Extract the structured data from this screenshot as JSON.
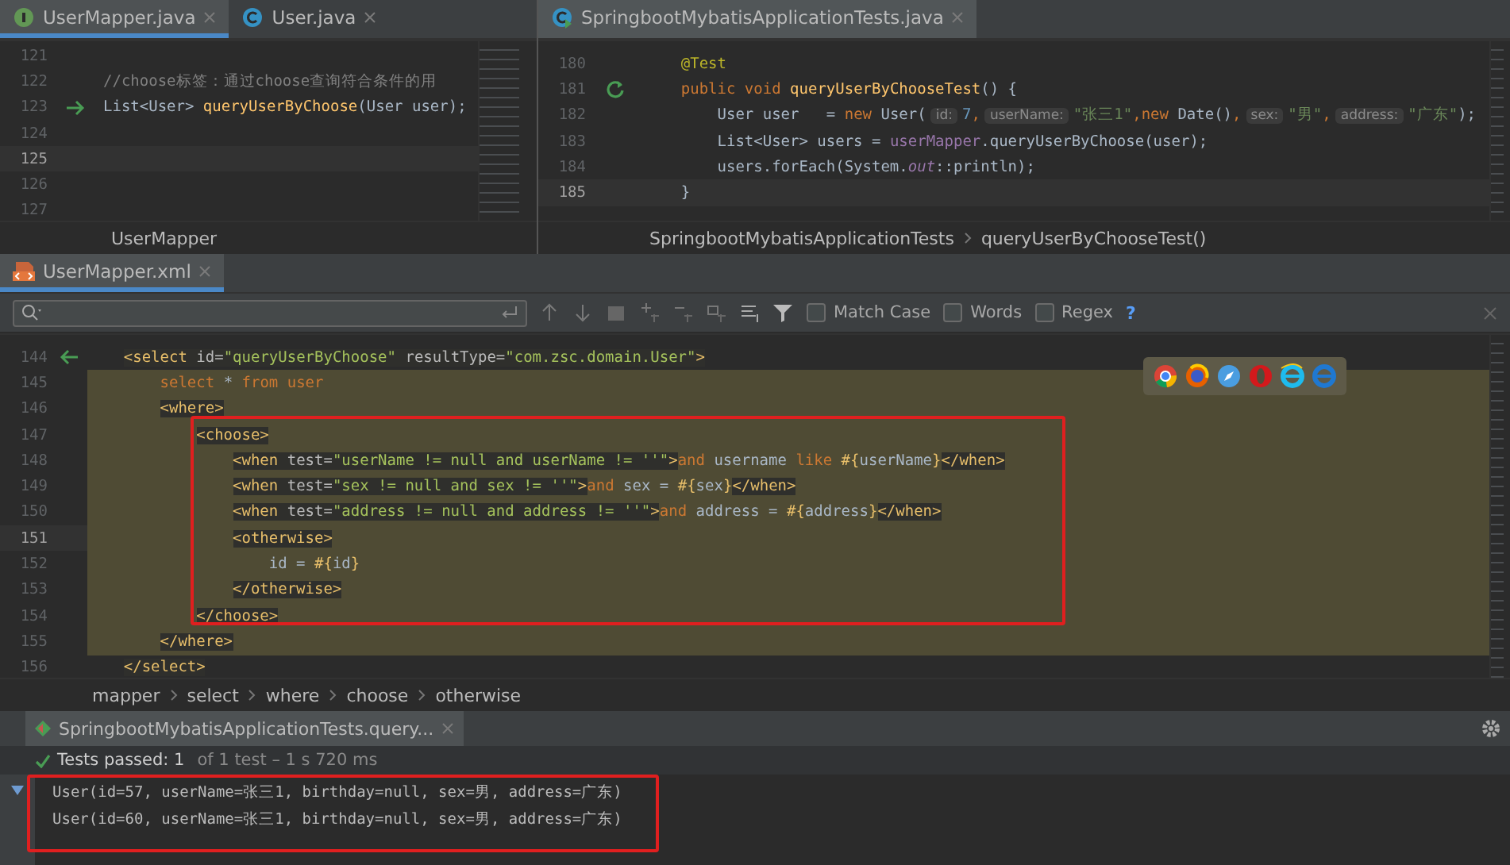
{
  "editors": [
    {
      "tabs": [
        {
          "label": "UserMapper.java",
          "kind": "interface",
          "selected": true
        },
        {
          "label": "User.java",
          "kind": "class",
          "selected": false
        }
      ],
      "lines": [
        {
          "number": "121",
          "current": false
        },
        {
          "number": "122",
          "current": false,
          "tokens": [
            {
              "text": "//choose标签：通过choose查询符合条件的用",
              "kind": "comment"
            }
          ]
        },
        {
          "number": "123",
          "current": false,
          "marker": {
            "kind": "implemented"
          },
          "tokens": [
            {
              "text": "List<User> ",
              "kind": "plain"
            },
            {
              "text": "queryUserByChoose",
              "kind": "method"
            },
            {
              "text": "(User user);",
              "kind": "plain"
            }
          ]
        },
        {
          "number": "124",
          "current": false
        },
        {
          "number": "125",
          "current": true
        },
        {
          "number": "126",
          "current": false
        },
        {
          "number": "127",
          "current": false
        }
      ],
      "breadcrumb": [
        "UserMapper"
      ]
    },
    {
      "tabs": [
        {
          "label": "SpringbootMybatisApplicationTests.java",
          "kind": "test-class",
          "selected": true
        }
      ],
      "lines": [
        {
          "number": "180",
          "current": false,
          "tokens": [
            {
              "text": "    @Test",
              "kind": "annotation"
            }
          ]
        },
        {
          "number": "181",
          "current": false,
          "marker": {
            "kind": "run"
          },
          "tokens": [
            {
              "text": "    public void ",
              "kind": "keyword"
            },
            {
              "text": "queryUserByChooseTest",
              "kind": "method"
            },
            {
              "text": "() {",
              "kind": "plain"
            }
          ]
        },
        {
          "number": "182",
          "current": false,
          "tokens": [
            {
              "text": "        User user   = ",
              "kind": "plain"
            },
            {
              "text": "new ",
              "kind": "keyword"
            },
            {
              "text": "User(",
              "kind": "plain"
            },
            {
              "text": "id:",
              "kind": "hint"
            },
            {
              "text": "7",
              "kind": "number"
            },
            {
              "text": ",",
              "kind": "keyword"
            },
            {
              "text": "userName:",
              "kind": "hint"
            },
            {
              "text": "\"张三1\"",
              "kind": "string"
            },
            {
              "text": ",new ",
              "kind": "keyword"
            },
            {
              "text": "Date()",
              "kind": "plain"
            },
            {
              "text": ",",
              "kind": "keyword"
            },
            {
              "text": "sex:",
              "kind": "hint"
            },
            {
              "text": "\"男\"",
              "kind": "string"
            },
            {
              "text": ",",
              "kind": "keyword"
            },
            {
              "text": "address:",
              "kind": "hint"
            },
            {
              "text": "\"广东\"",
              "kind": "string"
            },
            {
              "text": ");",
              "kind": "plain"
            }
          ]
        },
        {
          "number": "183",
          "current": false,
          "tokens": [
            {
              "text": "        List<User> users = ",
              "kind": "plain"
            },
            {
              "text": "userMapper",
              "kind": "field"
            },
            {
              "text": ".queryUserByChoose(user);",
              "kind": "plain"
            }
          ]
        },
        {
          "number": "184",
          "current": false,
          "tokens": [
            {
              "text": "        users.forEach(System.",
              "kind": "plain"
            },
            {
              "text": "out",
              "kind": "static"
            },
            {
              "text": "::println);",
              "kind": "plain"
            }
          ]
        },
        {
          "number": "185",
          "current": true,
          "tokens": [
            {
              "text": "    }",
              "kind": "plain"
            }
          ]
        }
      ],
      "breadcrumb": [
        "SpringbootMybatisApplicationTests",
        "queryUserByChooseTest()"
      ]
    }
  ],
  "xml_editor": {
    "tabs": [
      {
        "label": "UserMapper.xml",
        "kind": "xml",
        "selected": true
      }
    ],
    "find_bar": {
      "options": [
        {
          "label": "Match Case",
          "checked": false
        },
        {
          "label": "Words",
          "checked": false
        },
        {
          "label": "Regex",
          "checked": false
        }
      ],
      "help": "?"
    },
    "lines": [
      {
        "number": "144",
        "current": false,
        "highlighted": false,
        "marker": {
          "kind": "implementing"
        },
        "tokens": [
          {
            "text": "    <select",
            "kind": "tag"
          },
          {
            "text": " id=",
            "kind": "attr"
          },
          {
            "text": "\"queryUserByChoose\"",
            "kind": "value"
          },
          {
            "text": " resultType=",
            "kind": "attr"
          },
          {
            "text": "\"com.zsc.domain.User\"",
            "kind": "value"
          },
          {
            "text": ">",
            "kind": "tag"
          }
        ]
      },
      {
        "number": "145",
        "current": false,
        "highlighted": true,
        "tokens": [
          {
            "text": "        select ",
            "kind": "sql"
          },
          {
            "text": "* ",
            "kind": "plain"
          },
          {
            "text": "from user",
            "kind": "sql"
          }
        ]
      },
      {
        "number": "146",
        "current": false,
        "highlighted": true,
        "tokens": [
          {
            "text": "        <where>",
            "kind": "tag"
          }
        ]
      },
      {
        "number": "147",
        "current": false,
        "highlighted": true,
        "tokens": [
          {
            "text": "            <choose>",
            "kind": "tag"
          }
        ]
      },
      {
        "number": "148",
        "current": false,
        "highlighted": true,
        "tokens": [
          {
            "text": "                <when",
            "kind": "tag"
          },
          {
            "text": " test=",
            "kind": "attr"
          },
          {
            "text": "\"userName != null and userName != ''\"",
            "kind": "value"
          },
          {
            "text": ">",
            "kind": "tag"
          },
          {
            "text": "and ",
            "kind": "sql"
          },
          {
            "text": "username ",
            "kind": "plain"
          },
          {
            "text": "like ",
            "kind": "sql"
          },
          {
            "text": "#{",
            "kind": "param"
          },
          {
            "text": "userName",
            "kind": "plain"
          },
          {
            "text": "}",
            "kind": "param"
          },
          {
            "text": "</when>",
            "kind": "tag"
          }
        ]
      },
      {
        "number": "149",
        "current": false,
        "highlighted": true,
        "tokens": [
          {
            "text": "                <when",
            "kind": "tag"
          },
          {
            "text": " test=",
            "kind": "attr"
          },
          {
            "text": "\"sex != null and sex != ''\"",
            "kind": "value"
          },
          {
            "text": ">",
            "kind": "tag"
          },
          {
            "text": "and ",
            "kind": "sql"
          },
          {
            "text": "sex = ",
            "kind": "plain"
          },
          {
            "text": "#{",
            "kind": "param"
          },
          {
            "text": "sex",
            "kind": "plain"
          },
          {
            "text": "}",
            "kind": "param"
          },
          {
            "text": "</when>",
            "kind": "tag"
          }
        ]
      },
      {
        "number": "150",
        "current": false,
        "highlighted": true,
        "tokens": [
          {
            "text": "                <when",
            "kind": "tag"
          },
          {
            "text": " test=",
            "kind": "attr"
          },
          {
            "text": "\"address != null and address != ''\"",
            "kind": "value"
          },
          {
            "text": ">",
            "kind": "tag"
          },
          {
            "text": "and ",
            "kind": "sql"
          },
          {
            "text": "address = ",
            "kind": "plain"
          },
          {
            "text": "#{",
            "kind": "param"
          },
          {
            "text": "address",
            "kind": "plain"
          },
          {
            "text": "}",
            "kind": "param"
          },
          {
            "text": "</when>",
            "kind": "tag"
          }
        ]
      },
      {
        "number": "151",
        "current": true,
        "highlighted": true,
        "tokens": [
          {
            "text": "                <otherwise>",
            "kind": "tag"
          }
        ]
      },
      {
        "number": "152",
        "current": false,
        "highlighted": true,
        "tokens": [
          {
            "text": "                    id = ",
            "kind": "plain"
          },
          {
            "text": "#{",
            "kind": "param"
          },
          {
            "text": "id",
            "kind": "plain"
          },
          {
            "text": "}",
            "kind": "param"
          }
        ]
      },
      {
        "number": "153",
        "current": false,
        "highlighted": true,
        "tokens": [
          {
            "text": "                </otherwise>",
            "kind": "tag"
          }
        ]
      },
      {
        "number": "154",
        "current": false,
        "highlighted": true,
        "tokens": [
          {
            "text": "            </choose>",
            "kind": "tag"
          }
        ]
      },
      {
        "number": "155",
        "current": false,
        "highlighted": true,
        "tokens": [
          {
            "text": "        </where>",
            "kind": "tag"
          }
        ]
      },
      {
        "number": "156",
        "current": false,
        "highlighted": false,
        "tokens": [
          {
            "text": "    </select>",
            "kind": "tag"
          }
        ]
      }
    ],
    "browsers": [
      {
        "kind": "chrome"
      },
      {
        "kind": "firefox"
      },
      {
        "kind": "safari"
      },
      {
        "kind": "opera"
      },
      {
        "kind": "ie"
      },
      {
        "kind": "edge"
      }
    ],
    "breadcrumb": [
      "mapper",
      "select",
      "where",
      "choose",
      "otherwise"
    ]
  },
  "run_panel": {
    "tab": {
      "label": "SpringbootMybatisApplicationTests.query...",
      "selected": true
    },
    "status": "Tests passed: 1",
    "status_detail": "of 1 test – 1 s 720 ms",
    "output": [
      "User(id=57, userName=张三1, birthday=null, sex=男, address=广东)",
      "User(id=60, userName=张三1, birthday=null, sex=男, address=广东)"
    ]
  }
}
